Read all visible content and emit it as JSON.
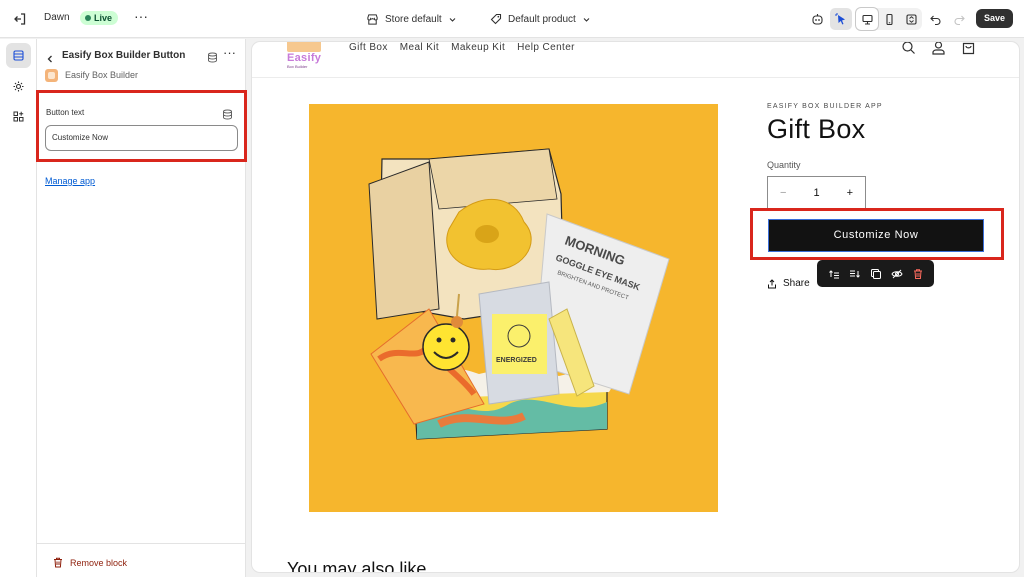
{
  "topbar": {
    "theme_name": "Dawn",
    "live_badge": "Live",
    "more_label": "···",
    "store_selector": "Store default",
    "template_selector": "Default product",
    "save_label": "Save"
  },
  "panel": {
    "block_title": "Easify Box Builder Button",
    "app_name": "Easify Box Builder",
    "field_label": "Button text",
    "field_value": "Customize Now",
    "manage_link": "Manage app",
    "remove_label": "Remove block"
  },
  "preview": {
    "logo_word": "Easify",
    "logo_sub": "Box Builder",
    "nav": [
      "Gift Box",
      "Meal Kit",
      "Makeup Kit",
      "Help Center"
    ],
    "vendor": "EASIFY BOX BUILDER APP",
    "title": "Gift Box",
    "quantity_label": "Quantity",
    "quantity_minus": "−",
    "quantity_value": "1",
    "quantity_plus": "+",
    "cta_label": "Customize Now",
    "share_label": "Share",
    "also_like": "You may also like",
    "photo_text": {
      "mask_1": "MORNING",
      "mask_2": "GOGGLE EYE MASK",
      "mask_3": "BRIGHTEN AND PROTECT",
      "pouch": "ENERGIZED"
    }
  },
  "colors": {
    "highlight": "#d9261c",
    "cta_bg": "#121212",
    "photo_bg": "#f6b62d",
    "save_bg": "#303030"
  }
}
